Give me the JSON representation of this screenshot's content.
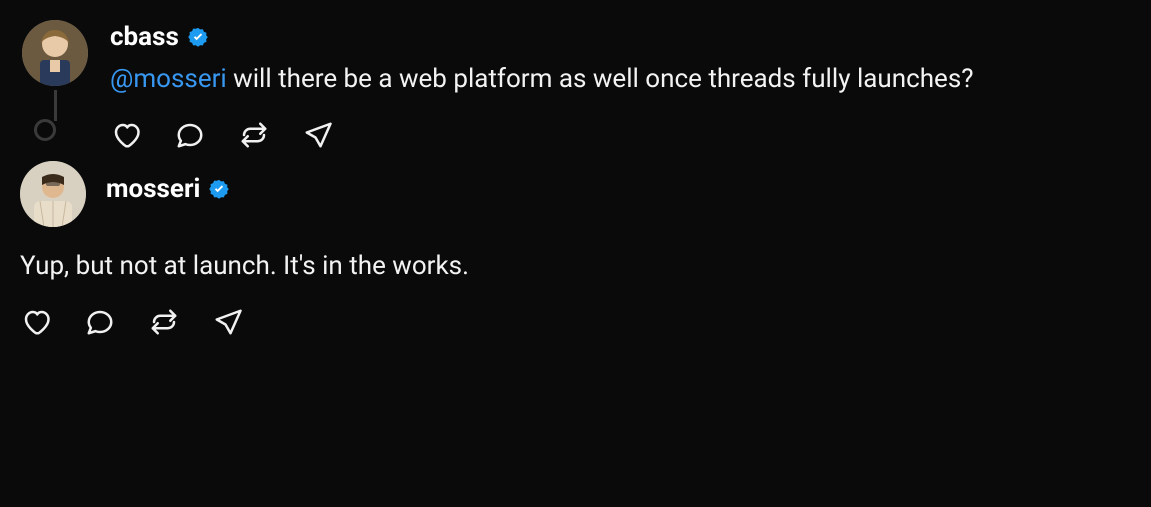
{
  "colors": {
    "verified": "#1d9bf0",
    "mention": "#3897f0"
  },
  "posts": [
    {
      "username": "cbass",
      "verified": true,
      "mention": "@mosseri",
      "body": " will there be a web platform as well once threads fully launches?"
    },
    {
      "username": "mosseri",
      "verified": true,
      "body": "Yup, but not at launch. It's in the works."
    }
  ]
}
